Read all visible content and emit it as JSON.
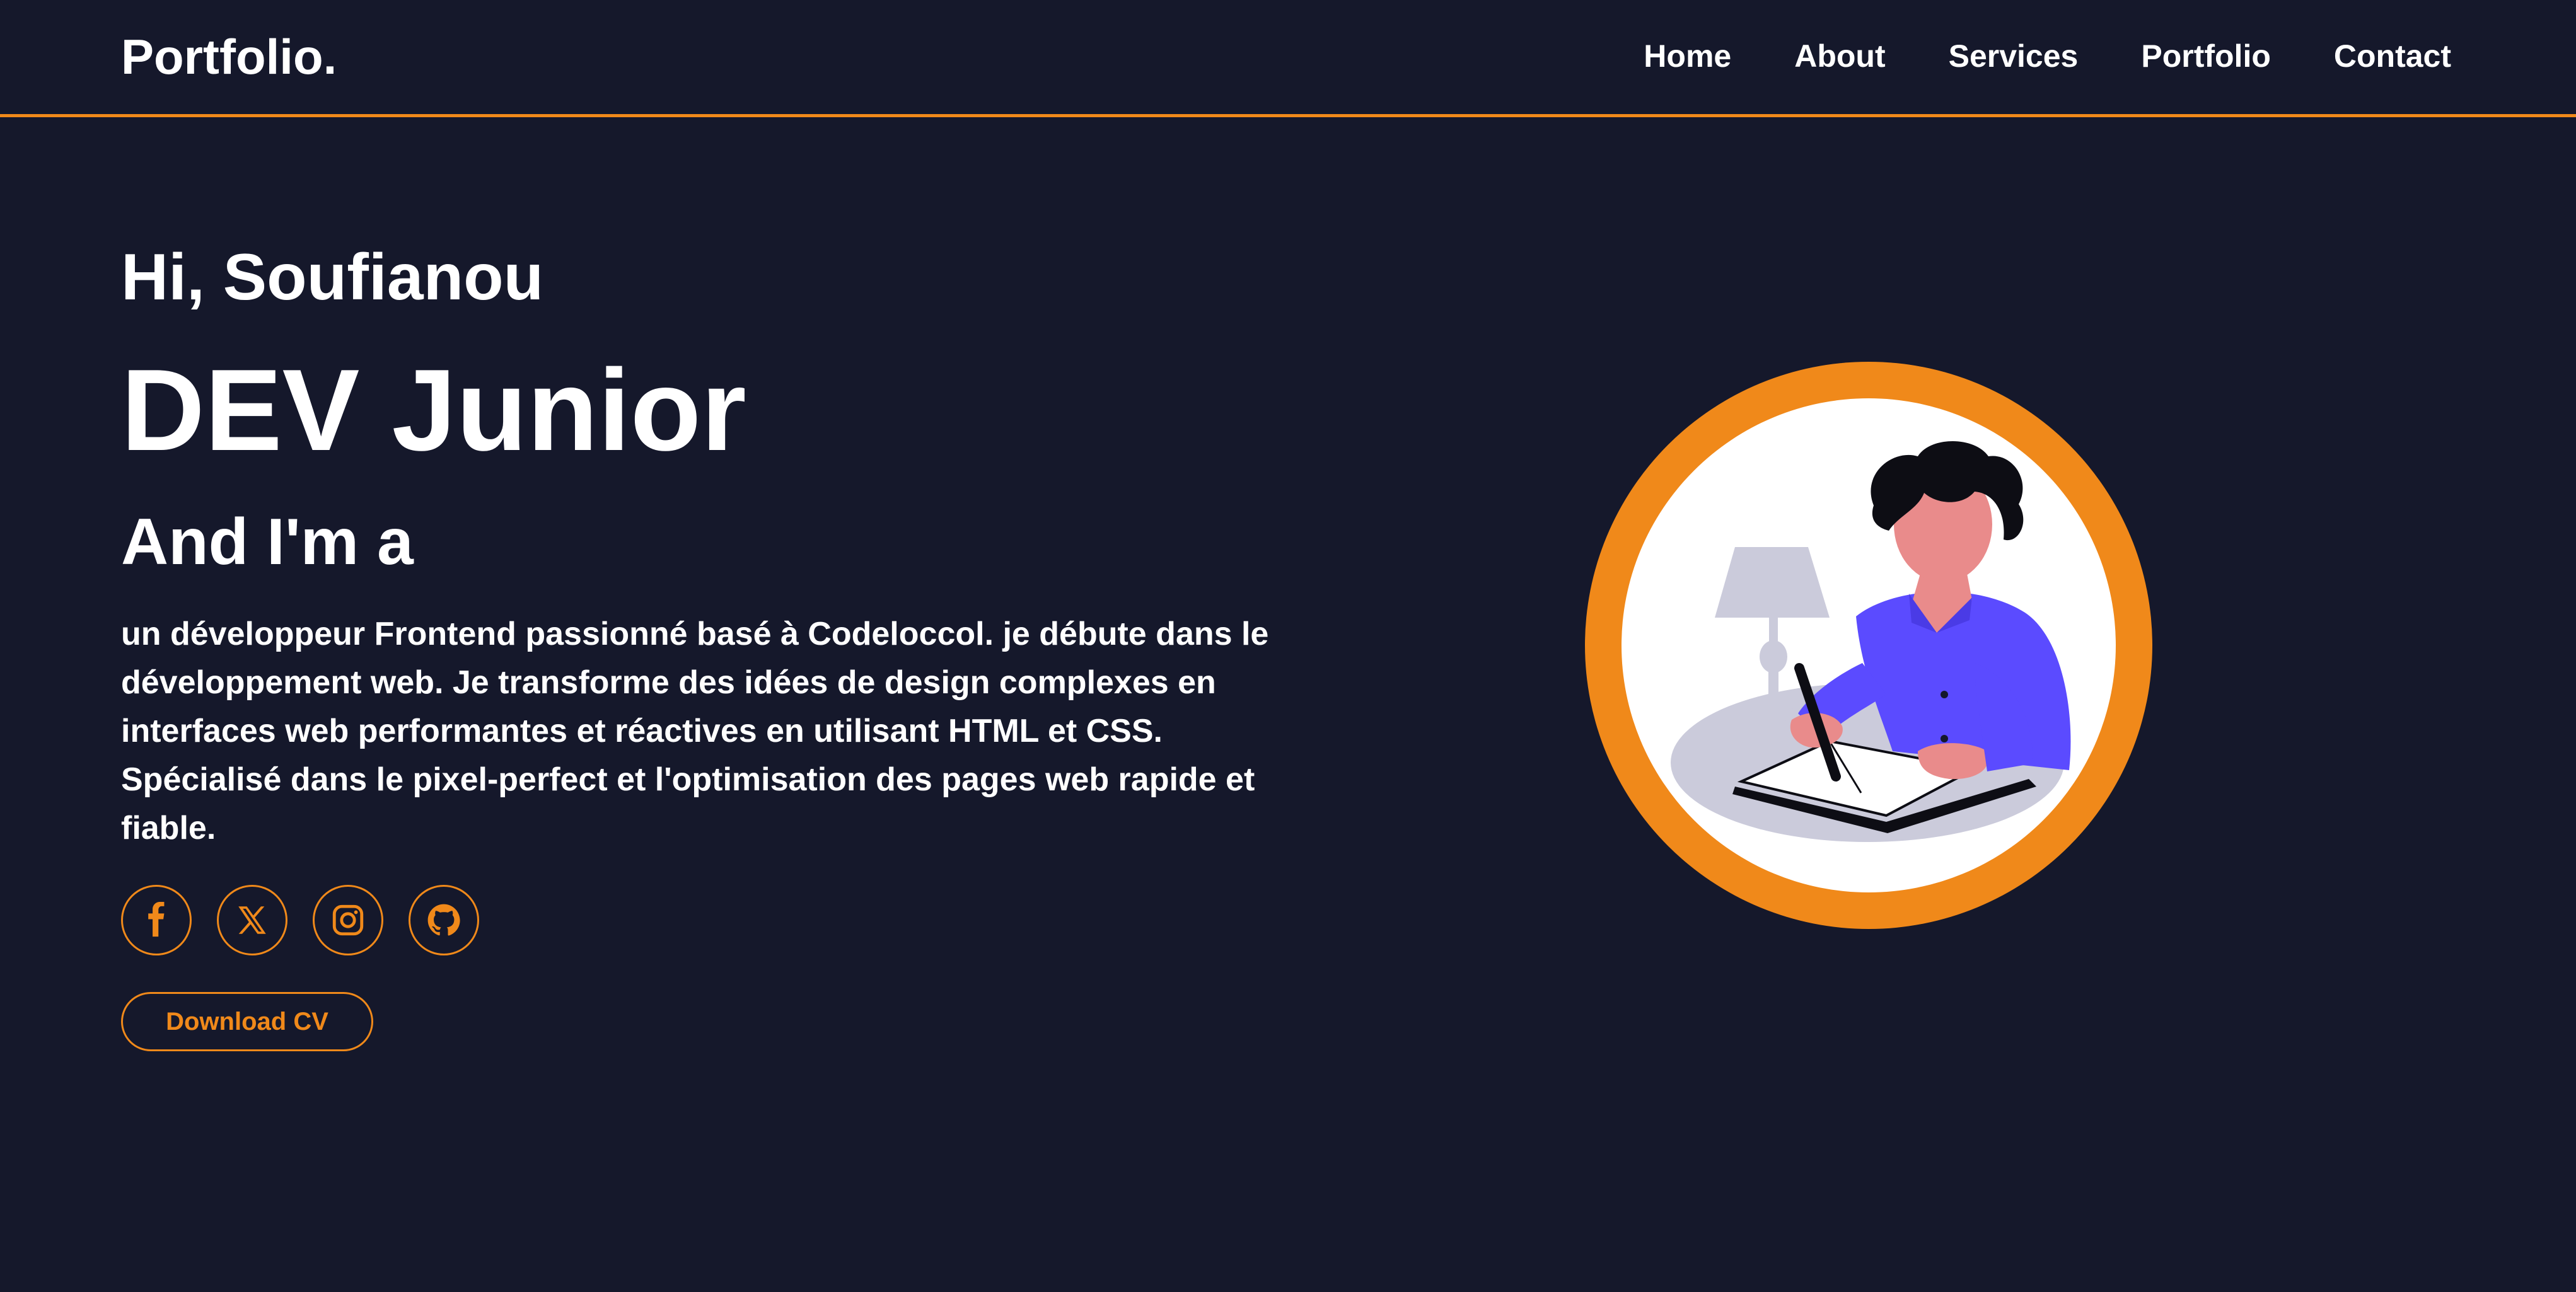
{
  "header": {
    "logo": "Portfolio.",
    "nav": [
      {
        "label": "Home"
      },
      {
        "label": "About"
      },
      {
        "label": "Services"
      },
      {
        "label": "Portfolio"
      },
      {
        "label": "Contact"
      }
    ]
  },
  "hero": {
    "greeting": "Hi, Soufianou",
    "role": "DEV Junior",
    "intro": "And I'm a",
    "description": "un développeur Frontend passionné basé à Codeloccol. je débute dans le développement web. Je transforme des idées de design complexes en interfaces web performantes et réactives en utilisant HTML et CSS. Spécialisé dans le pixel-perfect et l'optimisation des pages web rapide et fiable.",
    "socials": [
      {
        "icon": "facebook-icon"
      },
      {
        "icon": "x-twitter-icon"
      },
      {
        "icon": "instagram-icon"
      },
      {
        "icon": "github-icon"
      }
    ],
    "cv_button": "Download CV"
  },
  "colors": {
    "background": "#15182b",
    "accent": "#f0891a",
    "text": "#ffffff",
    "shirt": "#5b4bff",
    "skin": "#e98b8b",
    "table": "#cbcbdb"
  }
}
